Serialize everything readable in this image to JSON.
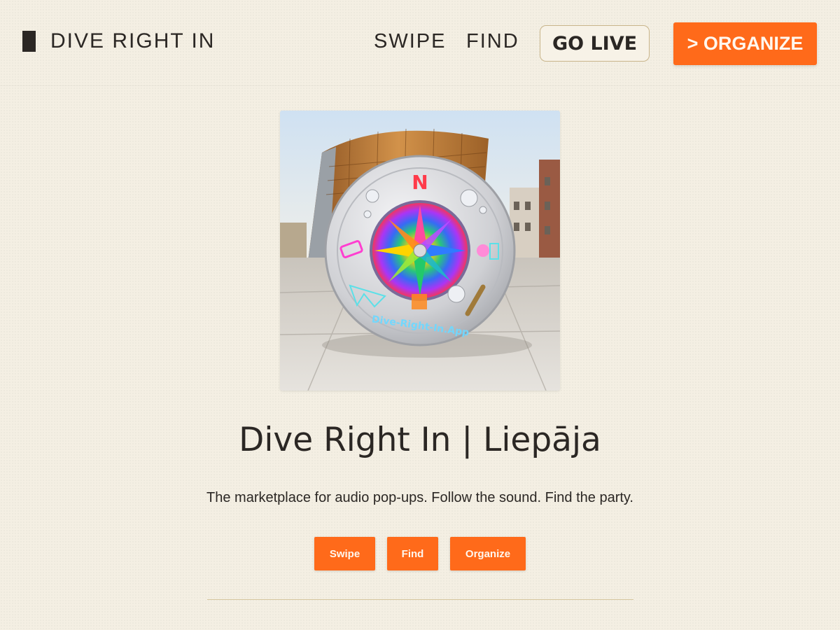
{
  "header": {
    "brand_name": "DIVE RIGHT IN",
    "nav": {
      "swipe": "SWIPE",
      "find": "FIND"
    },
    "go_live_label": "GO LIVE",
    "organize_cta_label": "> ORGANIZE"
  },
  "hero": {
    "image_text": "Dive-Right-In.App",
    "compass_letter": "N",
    "title": "Dive Right In | Liepāja",
    "subtitle": "The marketplace for audio pop-ups. Follow the sound. Find the party.",
    "actions": {
      "swipe": "Swipe",
      "find": "Find",
      "organize": "Organize"
    }
  },
  "colors": {
    "accent": "#ff6a1a",
    "background": "#f4efe3",
    "text": "#2b2724",
    "divider": "#d5c59e"
  }
}
